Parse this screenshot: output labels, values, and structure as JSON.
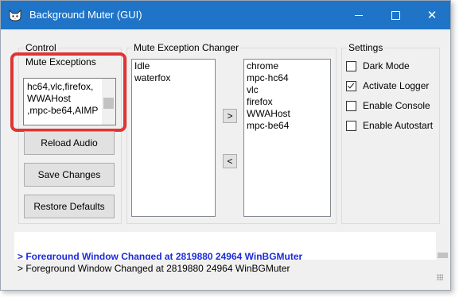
{
  "window": {
    "title": "Background Muter (GUI)",
    "icon": "cat-icon",
    "controls": {
      "minimize": "minimize-icon",
      "maximize": "maximize-icon",
      "close": "close-icon",
      "close_glyph": "✕"
    }
  },
  "control_group": {
    "label": "Control",
    "mute_exceptions_label": "Mute Exceptions",
    "mute_exceptions_lines": [
      "hc64,vlc,firefox,",
      "WWAHost",
      ",mpc-be64,AIMP"
    ],
    "buttons": {
      "reload": "Reload Audio",
      "save": "Save Changes",
      "restore": "Restore Defaults"
    }
  },
  "changer_group": {
    "label": "Mute Exception Changer",
    "left_list": [
      "Idle",
      "waterfox"
    ],
    "right_list": [
      "chrome",
      "mpc-hc64",
      "vlc",
      "firefox",
      "WWAHost",
      "mpc-be64"
    ],
    "move_right_label": ">",
    "move_left_label": "<"
  },
  "settings_group": {
    "label": "Settings",
    "options": [
      {
        "label": "Dark Mode",
        "checked": false
      },
      {
        "label": "Activate Logger",
        "checked": true
      },
      {
        "label": "Enable Console",
        "checked": false
      },
      {
        "label": "Enable Autostart",
        "checked": false
      }
    ]
  },
  "log": {
    "highlighted_line": "> Foreground Window Changed at 2819880 24964 WinBGMuter",
    "status_line": "> Foreground Window Changed at 2819880 24964 WinBGMuter"
  },
  "colors": {
    "titlebar": "#1f74c7",
    "highlight": "#e03434",
    "log_text": "#1c2bd8"
  }
}
